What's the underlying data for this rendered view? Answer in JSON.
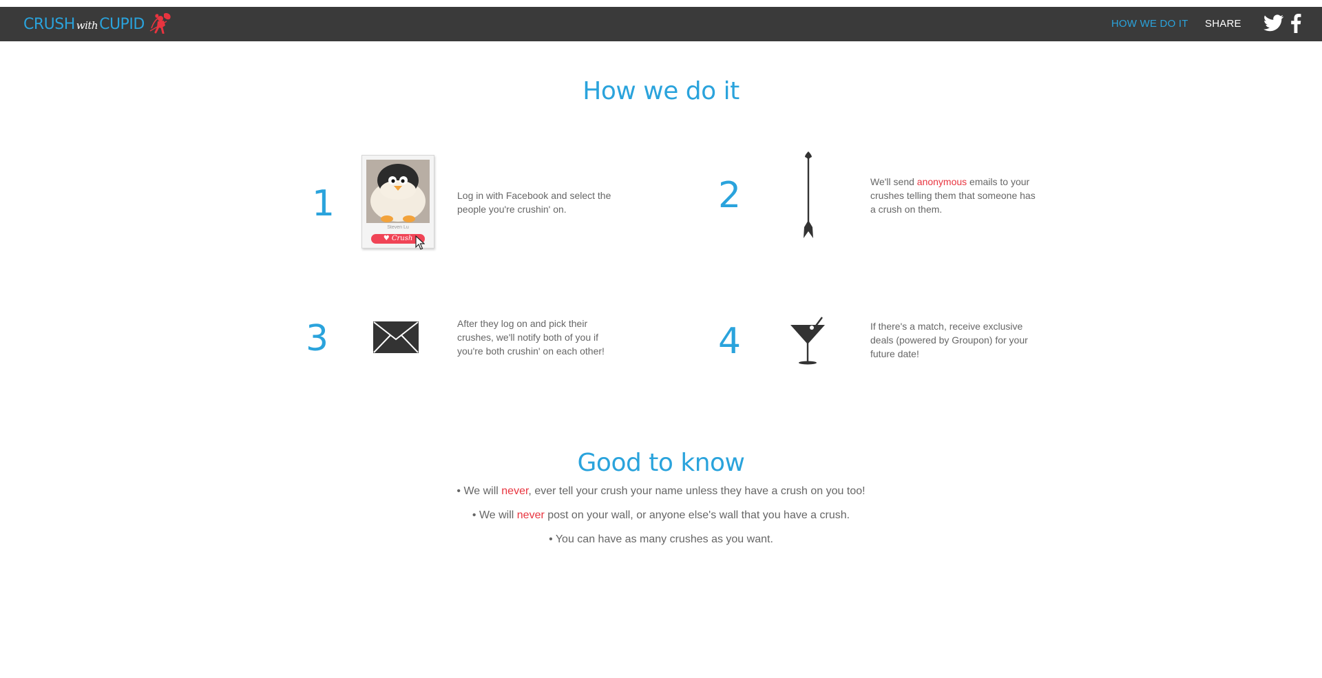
{
  "header": {
    "logo": {
      "part1": "CRUSH",
      "part2": "with",
      "part3": "CUPID"
    },
    "nav": {
      "how": "HOW WE DO IT",
      "share": "SHARE"
    },
    "social": [
      "twitter-icon",
      "facebook-icon"
    ]
  },
  "how_section": {
    "title": "How we do it",
    "steps": [
      {
        "num": "1",
        "text": "Log in with Facebook and select the people you're crushin' on.",
        "card_name": "Steven Lu",
        "card_button": "Crush"
      },
      {
        "num": "2",
        "pre": "We'll send ",
        "highlight": "anonymous",
        "post": " emails to your crushes telling them that someone has a crush on them."
      },
      {
        "num": "3",
        "text": "After they log on and pick their crushes, we'll notify both of you if you're both crushin' on each other!"
      },
      {
        "num": "4",
        "text": "If there's a match, receive exclusive deals (powered by Groupon) for your future date!"
      }
    ]
  },
  "good_section": {
    "title": "Good to know",
    "bullets": [
      {
        "pre": "• We will ",
        "highlight": "never",
        "post": ", ever tell your crush your name unless they have a crush on you too!"
      },
      {
        "pre": "• We will ",
        "highlight": "never",
        "post": " post on your wall, or anyone else's wall that you have a crush."
      },
      {
        "text": "• You can have as many crushes as you want."
      }
    ]
  },
  "colors": {
    "accent": "#2aa3dc",
    "highlight": "#e8343f",
    "navbar": "#3a3a3a"
  }
}
